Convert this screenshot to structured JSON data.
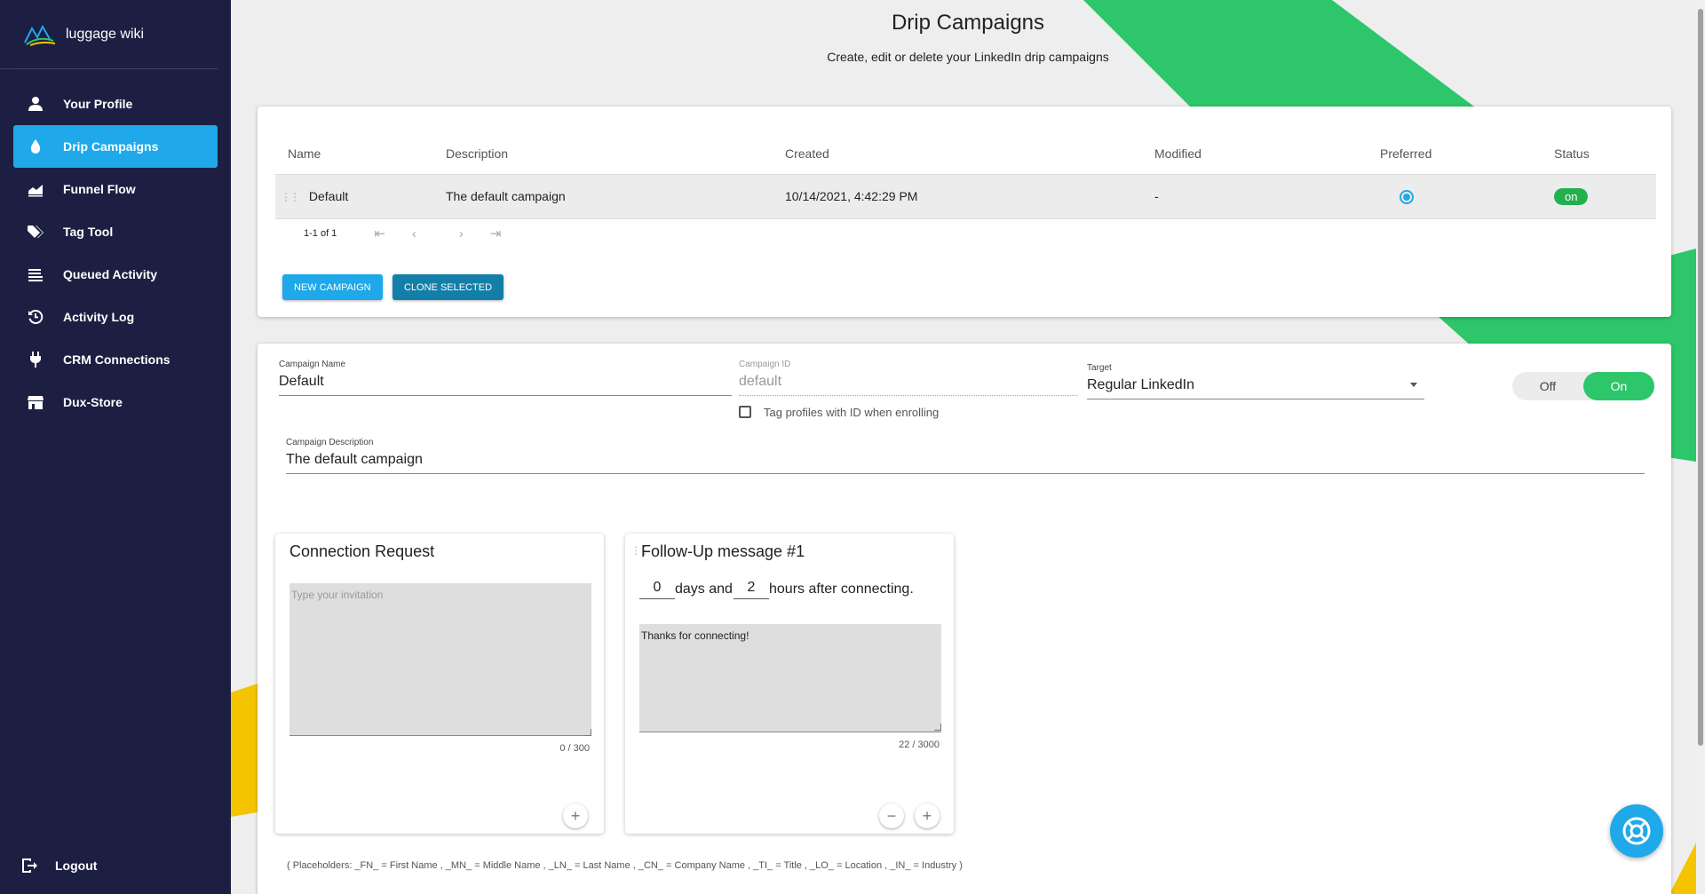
{
  "brand": {
    "name": "luggage wiki"
  },
  "sidebar": {
    "items": [
      {
        "label": "Your Profile",
        "icon": "person-icon"
      },
      {
        "label": "Drip Campaigns",
        "icon": "droplet-icon",
        "active": true
      },
      {
        "label": "Funnel Flow",
        "icon": "area-chart-icon"
      },
      {
        "label": "Tag Tool",
        "icon": "tags-icon"
      },
      {
        "label": "Queued Activity",
        "icon": "queue-icon"
      },
      {
        "label": "Activity Log",
        "icon": "history-icon"
      },
      {
        "label": "CRM Connections",
        "icon": "plug-icon"
      },
      {
        "label": "Dux-Store",
        "icon": "store-icon"
      }
    ],
    "logout_label": "Logout"
  },
  "header": {
    "title": "Drip Campaigns",
    "subtitle": "Create, edit or delete your LinkedIn drip campaigns"
  },
  "campaigns_table": {
    "columns": [
      "Name",
      "Description",
      "Created",
      "Modified",
      "Preferred",
      "Status"
    ],
    "rows": [
      {
        "name": "Default",
        "description": "The default campaign",
        "created": "10/14/2021, 4:42:29 PM",
        "modified": "-",
        "preferred": true,
        "status": "on"
      }
    ],
    "pagination": "1-1 of 1",
    "new_campaign_label": "NEW CAMPAIGN",
    "clone_selected_label": "CLONE SELECTED"
  },
  "campaign_form": {
    "name_label": "Campaign Name",
    "name_value": "Default",
    "id_label": "Campaign ID",
    "id_value": "default",
    "tag_checkbox_label": "Tag profiles with ID when enrolling",
    "target_label": "Target",
    "target_value": "Regular LinkedIn",
    "toggle_off": "Off",
    "toggle_on": "On",
    "description_label": "Campaign Description",
    "description_value": "The default campaign"
  },
  "connection_request": {
    "title": "Connection Request",
    "placeholder": "Type your invitation",
    "counter": "0 / 300"
  },
  "follow_up": {
    "title": "Follow-Up message #1",
    "days": "0",
    "days_text": "days and",
    "hours": "2",
    "hours_text": "hours after connecting.",
    "message": "Thanks for connecting!",
    "counter": "22 / 3000"
  },
  "placeholders_note": "( Placeholders: _FN_ = First Name , _MN_ = Middle Name , _LN_ = Last Name , _CN_ = Company Name , _TI_ = Title , _LO_ = Location , _IN_ = Industry )",
  "colors": {
    "sidebar_bg": "#1d1f42",
    "accent_blue": "#1fa8ea",
    "accent_green": "#2dc66a",
    "accent_yellow": "#f5c400"
  }
}
